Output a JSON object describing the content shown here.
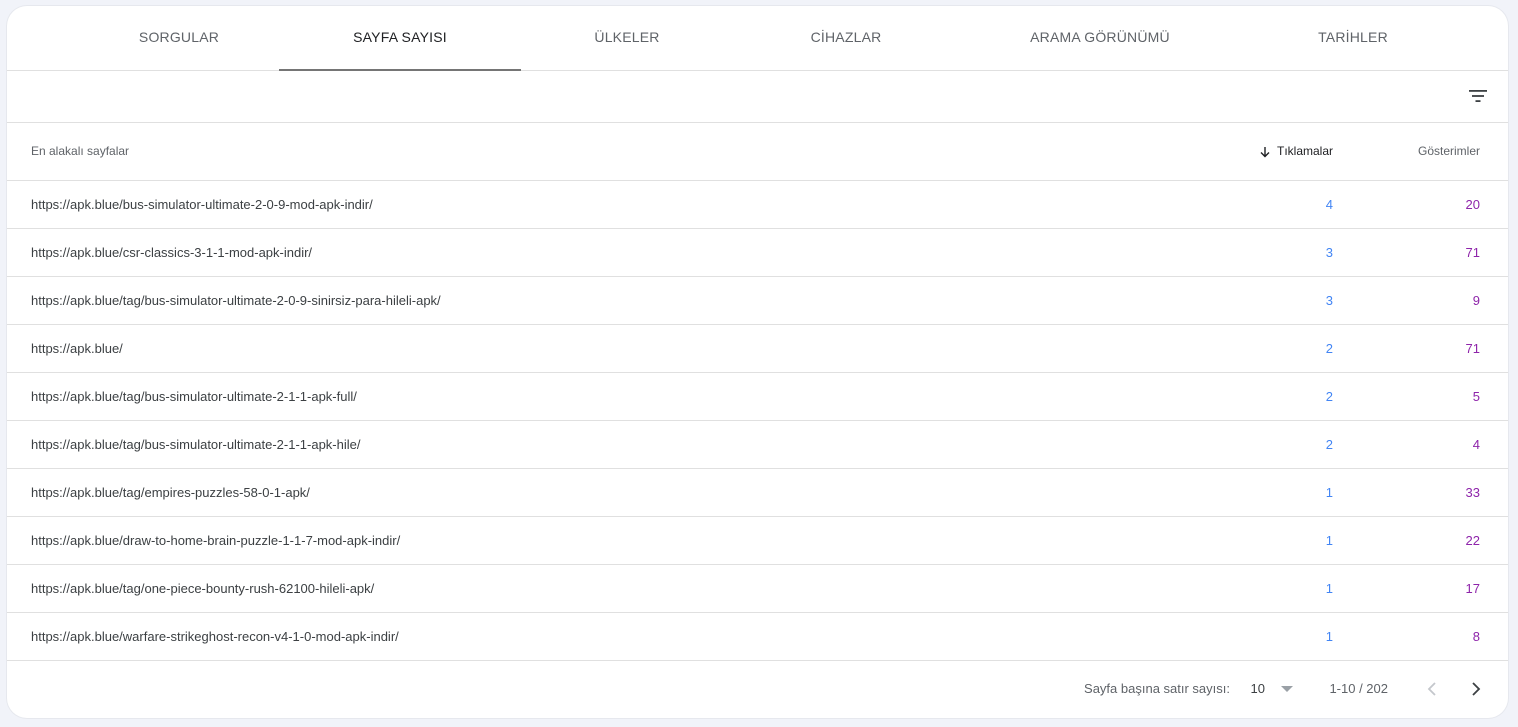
{
  "tabs": [
    {
      "label": "SORGULAR",
      "active": false
    },
    {
      "label": "SAYFA SAYISI",
      "active": true
    },
    {
      "label": "ÜLKELER",
      "active": false
    },
    {
      "label": "CİHAZLAR",
      "active": false
    },
    {
      "label": "ARAMA GÖRÜNÜMÜ",
      "active": false
    },
    {
      "label": "TARİHLER",
      "active": false
    }
  ],
  "filter": {
    "icon": "filter-list-icon"
  },
  "table": {
    "columns": {
      "url": "En alakalı sayfalar",
      "clicks": "Tıklamalar",
      "impressions": "Gösterimler",
      "sort_icon": "arrow-downward-icon"
    },
    "rows": [
      {
        "url": "https://apk.blue/bus-simulator-ultimate-2-0-9-mod-apk-indir/",
        "clicks": "4",
        "impressions": "20"
      },
      {
        "url": "https://apk.blue/csr-classics-3-1-1-mod-apk-indir/",
        "clicks": "3",
        "impressions": "71"
      },
      {
        "url": "https://apk.blue/tag/bus-simulator-ultimate-2-0-9-sinirsiz-para-hileli-apk/",
        "clicks": "3",
        "impressions": "9"
      },
      {
        "url": "https://apk.blue/",
        "clicks": "2",
        "impressions": "71"
      },
      {
        "url": "https://apk.blue/tag/bus-simulator-ultimate-2-1-1-apk-full/",
        "clicks": "2",
        "impressions": "5"
      },
      {
        "url": "https://apk.blue/tag/bus-simulator-ultimate-2-1-1-apk-hile/",
        "clicks": "2",
        "impressions": "4"
      },
      {
        "url": "https://apk.blue/tag/empires-puzzles-58-0-1-apk/",
        "clicks": "1",
        "impressions": "33"
      },
      {
        "url": "https://apk.blue/draw-to-home-brain-puzzle-1-1-7-mod-apk-indir/",
        "clicks": "1",
        "impressions": "22"
      },
      {
        "url": "https://apk.blue/tag/one-piece-bounty-rush-62100-hileli-apk/",
        "clicks": "1",
        "impressions": "17"
      },
      {
        "url": "https://apk.blue/warfare-strikeghost-recon-v4-1-0-mod-apk-indir/",
        "clicks": "1",
        "impressions": "8"
      }
    ]
  },
  "pagination": {
    "rows_per_page_label": "Sayfa başına satır sayısı:",
    "rows_per_page_value": "10",
    "range": "1-10 / 202"
  },
  "colors": {
    "clicks": "#4285f4",
    "impressions": "#8e24aa",
    "tab_underline": "#757575"
  }
}
